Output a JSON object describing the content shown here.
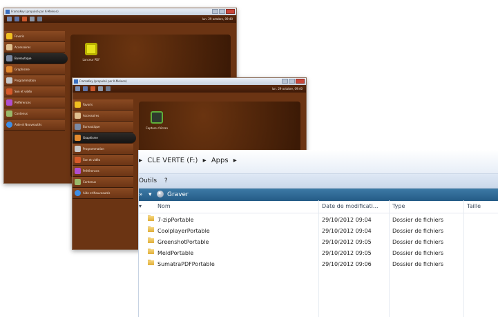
{
  "framakey_back": {
    "title": "FramaKey (propulsé par K-Meleon)",
    "clock": "lun. 29 octobre, 09:40",
    "menu": [
      {
        "label": "Favoris"
      },
      {
        "label": "Accessoires"
      },
      {
        "label": "Bureautique"
      },
      {
        "label": "Graphisme"
      },
      {
        "label": "Programmation"
      },
      {
        "label": "Son et vidéo"
      },
      {
        "label": "Préférences"
      },
      {
        "label": "Contenus"
      },
      {
        "label": "Aide et Nouveautés"
      }
    ],
    "active_index": 2,
    "app": {
      "label": "Lanceur PDF",
      "icon": "pdf-launcher-icon"
    }
  },
  "framakey_front": {
    "title": "FramaKey (propulsé par K-Meleon)",
    "clock": "lun. 29 octobre, 09:40",
    "menu": [
      {
        "label": "Favoris"
      },
      {
        "label": "Accessoires"
      },
      {
        "label": "Bureautique"
      },
      {
        "label": "Graphisme"
      },
      {
        "label": "Programmation"
      },
      {
        "label": "Son et vidéo"
      },
      {
        "label": "Préférences"
      },
      {
        "label": "Contenus"
      },
      {
        "label": "Aide et Nouveautés"
      }
    ],
    "active_index": 3,
    "app": {
      "label": "Capture d'écran",
      "icon": "screenshot-icon"
    }
  },
  "explorer": {
    "breadcrumb": {
      "drive": "CLE VERTE (F:)",
      "folder": "Apps",
      "separator": "▸"
    },
    "menu": {
      "tools": "Outils",
      "help": "?"
    },
    "toolbar": {
      "burn": "Graver"
    },
    "columns": {
      "name": "Nom",
      "date": "Date de modificati...",
      "type": "Type",
      "size": "Taille"
    },
    "files": [
      {
        "name": "7-zipPortable",
        "date": "29/10/2012 09:04",
        "type": "Dossier de fichiers"
      },
      {
        "name": "CoolplayerPortable",
        "date": "29/10/2012 09:04",
        "type": "Dossier de fichiers"
      },
      {
        "name": "GreenshotPortable",
        "date": "29/10/2012 09:05",
        "type": "Dossier de fichiers"
      },
      {
        "name": "MeldPortable",
        "date": "29/10/2012 09:05",
        "type": "Dossier de fichiers"
      },
      {
        "name": "SumatraPDFPortable",
        "date": "29/10/2012 09:06",
        "type": "Dossier de fichiers"
      }
    ]
  },
  "colors": {
    "framakey_bg": "#6b3413",
    "explorer_toolbar": "#2f6d97",
    "menu_bar": "#d6e1f0",
    "folder": "#e9be52"
  }
}
